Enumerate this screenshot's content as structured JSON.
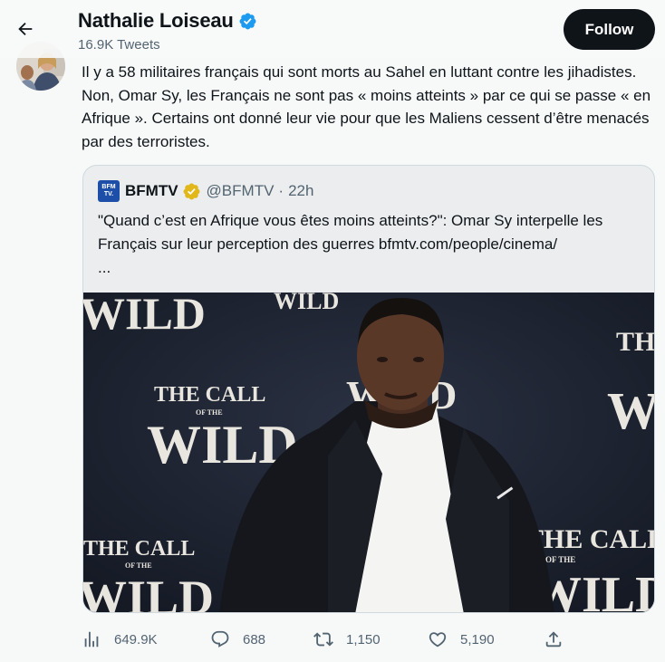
{
  "header": {
    "back_icon": "arrow-left-icon",
    "name": "Nathalie Loiseau",
    "verified_icon": "verified-badge-icon",
    "tweet_count": "16.9K Tweets",
    "follow_label": "Follow"
  },
  "tweet": {
    "avatar_icon": "profile-photo",
    "text": "Il y a 58 militaires français qui sont morts au Sahel en luttant contre les jihadistes. Non, Omar Sy, les Français ne sont pas « moins atteints » par ce qui se passe « en Afrique ». Certains ont donné leur vie pour que les Maliens cessent d’être menacés par des terroristes."
  },
  "quote": {
    "logo_text": "BFM TV.",
    "name": "BFMTV",
    "badge_icon": "gold-verified-badge-icon",
    "handle": "@BFMTV",
    "separator": "·",
    "time": "22h",
    "text": "\"Quand c’est en Afrique vous êtes moins atteints?\": Omar Sy interpelle les Français sur leur perception des guerres bfmtv.com/people/cinema/",
    "ellipsis": "...",
    "photo": {
      "backdrop_text": [
        "THE CALL",
        "OF THE",
        "WILD"
      ]
    }
  },
  "actions": {
    "views": {
      "icon": "bar-chart-icon",
      "count": "649.9K"
    },
    "replies": {
      "icon": "reply-bubble-icon",
      "count": "688"
    },
    "retweets": {
      "icon": "retweet-icon",
      "count": "1,150"
    },
    "likes": {
      "icon": "heart-icon",
      "count": "5,190"
    },
    "share": {
      "icon": "share-upload-icon"
    }
  },
  "colors": {
    "background": "#f7f9f9",
    "text": "#0f1419",
    "muted": "#536471",
    "verified_blue": "#1d9bf0",
    "gold": "#e2b719",
    "bfm_blue": "#1e4fa8",
    "follow_bg": "#0f1419"
  }
}
